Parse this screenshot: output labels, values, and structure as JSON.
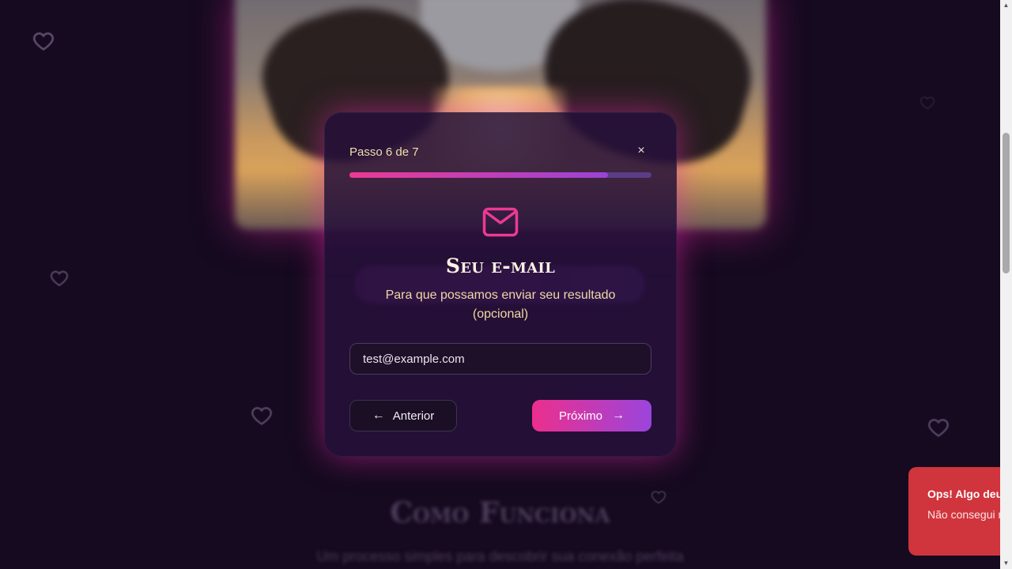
{
  "modal": {
    "step_label": "Passo 6 de 7",
    "close_symbol": "×",
    "progress": 0.857,
    "icon": "mail-icon",
    "title": "Seu e-mail",
    "subtitle": "Para que possamos enviar seu resultado (opcional)",
    "email_value": "test@example.com",
    "prev_label": "Anterior",
    "next_label": "Próximo"
  },
  "toast": {
    "title": "Ops! Algo deu",
    "body": "Não consegui momento. Ten"
  },
  "background": {
    "section_title": "Como Funciona",
    "section_subtitle": "Um processo simples para descobrir sua conexão perfeita"
  },
  "colors": {
    "accent_pink": "#ec2f8d",
    "accent_purple": "#9a45dc",
    "toast_red": "#d0343c",
    "page_bg": "#150a1f"
  }
}
